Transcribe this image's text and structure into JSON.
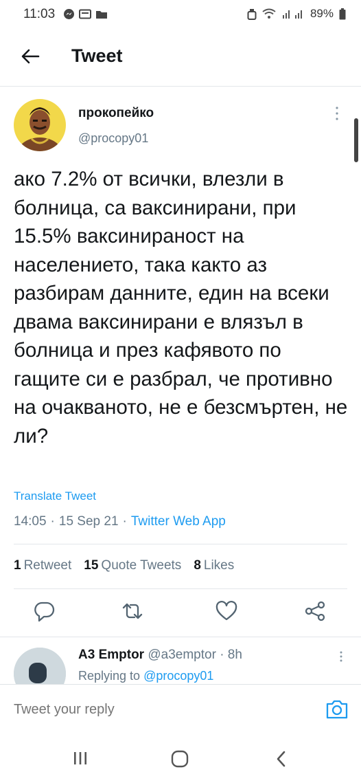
{
  "status_bar": {
    "time": "11:03",
    "battery": "89%"
  },
  "header": {
    "title": "Tweet",
    "back_icon": "arrow-left-icon"
  },
  "tweet": {
    "author_name": "прокопейко",
    "author_handle": "@procopy01",
    "text": "ако 7.2% от всички, влезли в болница, са ваксинирани, при 15.5% ваксинираност на населението, така както аз разбирам данните, един на всеки двама ваксинирани е влязъл в болница и през кафявото по гащите си е разбрал, че противно на очакваното, не е безсмъртен, не ли?",
    "translate_label": "Translate Tweet",
    "time": "14:05",
    "date": "15 Sep 21",
    "source": "Twitter Web App",
    "separator": "·",
    "stats": {
      "retweets_count": "1",
      "retweets_label": "Retweet",
      "quotes_count": "15",
      "quotes_label": "Quote Tweets",
      "likes_count": "8",
      "likes_label": "Likes"
    }
  },
  "actions": [
    "reply-icon",
    "retweet-icon",
    "like-icon",
    "share-icon"
  ],
  "reply": {
    "author_name": "A3 Emptor",
    "author_handle": "@a3emptor",
    "time": "· 8h",
    "replying_prefix": "Replying to",
    "replying_handle": "@procopy01"
  },
  "compose": {
    "placeholder": "Tweet your reply"
  },
  "colors": {
    "accent": "#1d9bf0",
    "muted": "#657786",
    "text": "#14171a"
  }
}
